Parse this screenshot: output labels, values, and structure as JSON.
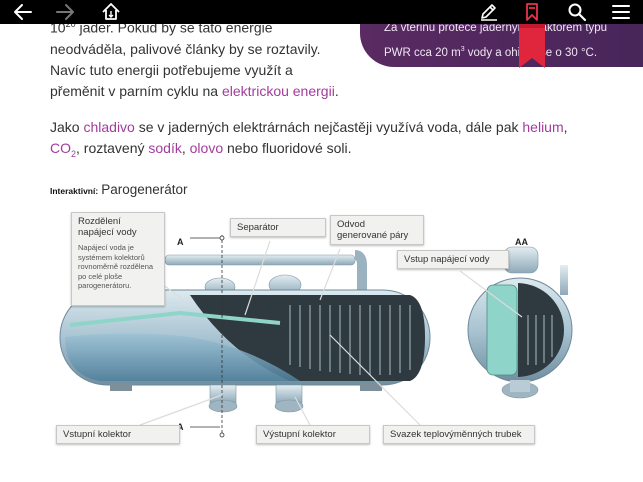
{
  "toolbar": {
    "back_icon": "arrow-left-icon",
    "forward_icon": "arrow-right-icon",
    "home_icon": "home-icon",
    "edit_icon": "pencil-icon",
    "bookmark_icon": "bookmark-icon",
    "search_icon": "search-icon",
    "menu_icon": "menu-icon"
  },
  "sidecard": {
    "text_line1": "Za vteřinu proteče jaderným reaktorem typu",
    "text_line2_a": "PWR cca 20 m",
    "text_line2_sup": "3",
    "text_line2_b": " vody a ohřeje se o 30 °C.",
    "color": "#4e2860"
  },
  "paragraph1": {
    "base": "10",
    "sup": "20",
    "text": " jader. Pokud by se tato energie neodváděla, palivové články by se roztavily. Navíc tuto energii potřebujeme využít a přeměnit v parním cyklu na ",
    "link": "elektrickou energii",
    "end": "."
  },
  "paragraph2": {
    "t1": "Jako ",
    "link_coolant": "chladivo",
    "t2": " se v jaderných elektrárnách nejčastěji využívá voda, dále pak ",
    "link_helium": "helium",
    "t3": ", ",
    "link_co2": "CO",
    "co2_sub": "2",
    "t4": ", roztavený ",
    "link_sodium": "sodík",
    "t5": ", ",
    "link_lead": "olovo",
    "t6": " nebo fluoridové soli."
  },
  "interactive": {
    "label": "Interaktivní:",
    "title": "Parogenerátor"
  },
  "diagram": {
    "section_a_top": "A",
    "section_a_bottom": "A",
    "section_aa": "AA",
    "callouts": {
      "feedwater_distribution": "Rozdělení napájecí vody",
      "feedwater_distribution_desc": "Napájecí voda je systémem kolektorů rovnoměrně rozdělena po celé ploše parogenerátoru.",
      "separator": "Separátor",
      "steam_outlet": "Odvod generované páry",
      "feedwater_inlet": "Vstup napájecí vody",
      "inlet_collector": "Vstupní kolektor",
      "outlet_collector": "Výstupní kolektor",
      "tube_bundle": "Svazek teplovýměnných trubek"
    },
    "colors": {
      "vessel": "#a9c4d2",
      "water": "#6f9db8",
      "steel": "#8a9aa4"
    }
  }
}
